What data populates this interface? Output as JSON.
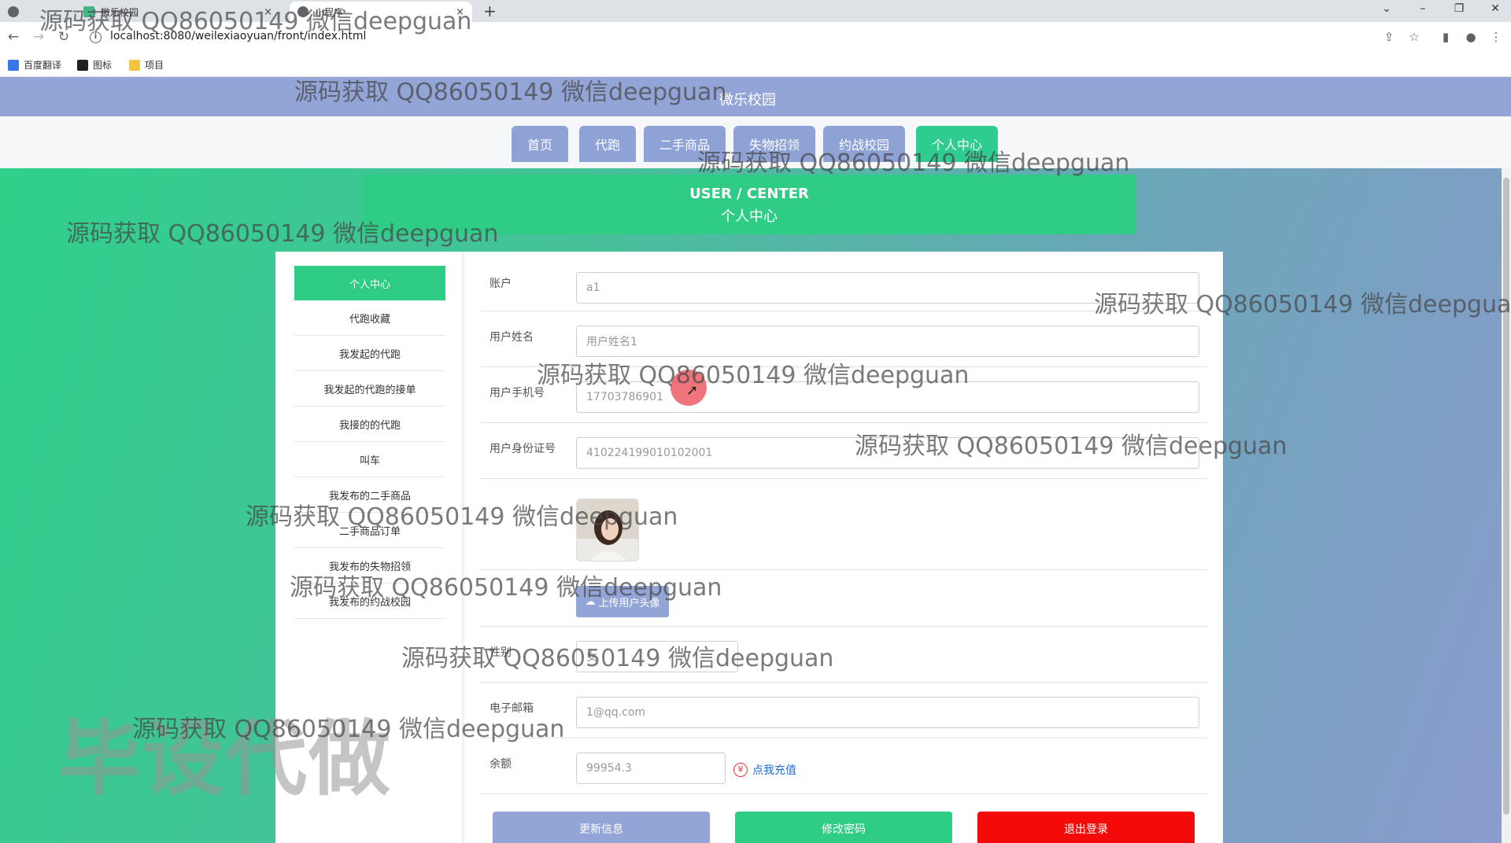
{
  "browser": {
    "tabs": [
      {
        "title": ""
      },
      {
        "title": "微乐校园"
      },
      {
        "title": "小程序"
      }
    ],
    "url": "localhost:8080/weilexiaoyuan/front/index.html",
    "bookmarks": [
      "百度翻译",
      "图标",
      "项目"
    ],
    "tab_close": "×",
    "new_tab": "+"
  },
  "header": {
    "title": "微乐校园"
  },
  "nav": {
    "items": [
      "首页",
      "代跑",
      "二手商品",
      "失物招领",
      "约战校园",
      "个人中心"
    ]
  },
  "banner": {
    "en": "USER / CENTER",
    "zh": "个人中心"
  },
  "sidebar": {
    "items": [
      "个人中心",
      "代跑收藏",
      "我发起的代跑",
      "我发起的代跑的接单",
      "我接的的代跑",
      "叫车",
      "我发布的二手商品",
      "二手商品订单",
      "我发布的失物招领",
      "我发布的约战校园"
    ]
  },
  "form": {
    "account_label": "账户",
    "account_value": "a1",
    "name_label": "用户姓名",
    "name_value": "用户姓名1",
    "phone_label": "用户手机号",
    "phone_value": "17703786901",
    "id_label": "用户身份证号",
    "id_value": "410224199010102001",
    "upload_label": "上传用户头像",
    "gender_label": "性别",
    "gender_value": "女",
    "email_label": "电子邮箱",
    "email_value": "1@qq.com",
    "balance_label": "余额",
    "balance_value": "99954.3",
    "recharge_label": "点我充值"
  },
  "actions": {
    "update": "更新信息",
    "password": "修改密码",
    "logout": "退出登录"
  },
  "colors": {
    "green": "#2ecc85",
    "blue": "#93a5d7",
    "red": "#ff0000"
  },
  "watermark": {
    "text": "源码获取 QQ86050149 微信deepguan",
    "big": "毕设代做"
  }
}
